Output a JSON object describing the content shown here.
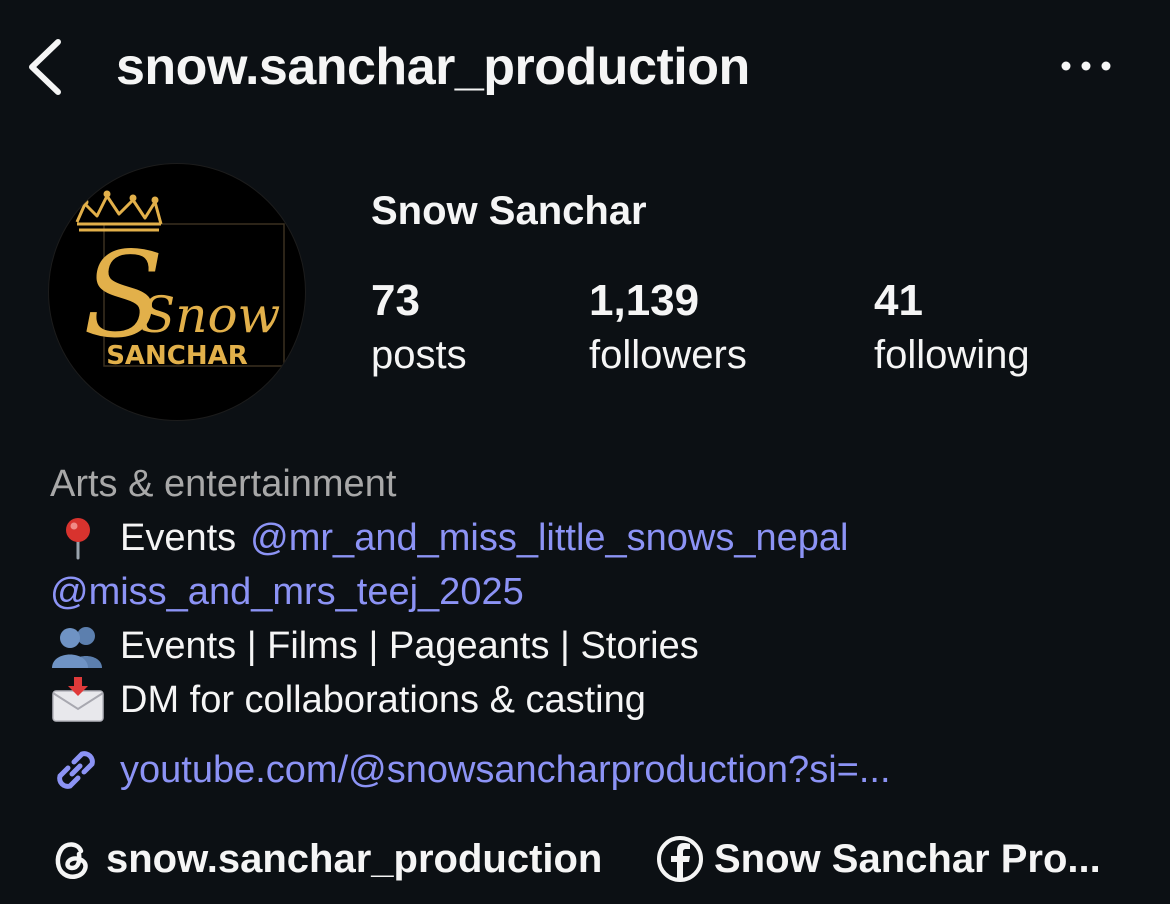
{
  "header": {
    "back_icon": "chevron-left-icon",
    "username": "snow.sanchar_production",
    "more_icon": "more-horizontal-icon"
  },
  "profile": {
    "avatar_logo_script": "Snow",
    "avatar_logo_caption": "SANCHAR",
    "display_name": "Snow Sanchar",
    "stats": {
      "posts": {
        "count": "73",
        "label": "posts"
      },
      "followers": {
        "count": "1,139",
        "label": "followers"
      },
      "following": {
        "count": "41",
        "label": "following"
      }
    }
  },
  "bio": {
    "category": "Arts & entertainment",
    "line1_icon": "pin-emoji",
    "line1_text": "Events",
    "mention1": "@mr_and_miss_little_snows_nepal",
    "mention2": "@miss_and_mrs_teej_2025",
    "line3_icon": "people-emoji",
    "line3_text": "Events | Films | Pageants | Stories",
    "line4_icon": "envelope-emoji",
    "line4_text": "DM for collaborations & casting",
    "link_icon": "link-icon",
    "link": "youtube.com/@snowsancharproduction?si=..."
  },
  "social": {
    "threads_icon": "threads-icon",
    "threads": "snow.sanchar_production",
    "facebook_icon": "facebook-icon",
    "facebook": "Snow Sanchar Pro..."
  },
  "colors": {
    "background": "#0c1014",
    "text": "#f5f5f5",
    "secondary": "#a8a8a8",
    "link": "#8c93f5",
    "logo_gold": "#e2b04a"
  }
}
